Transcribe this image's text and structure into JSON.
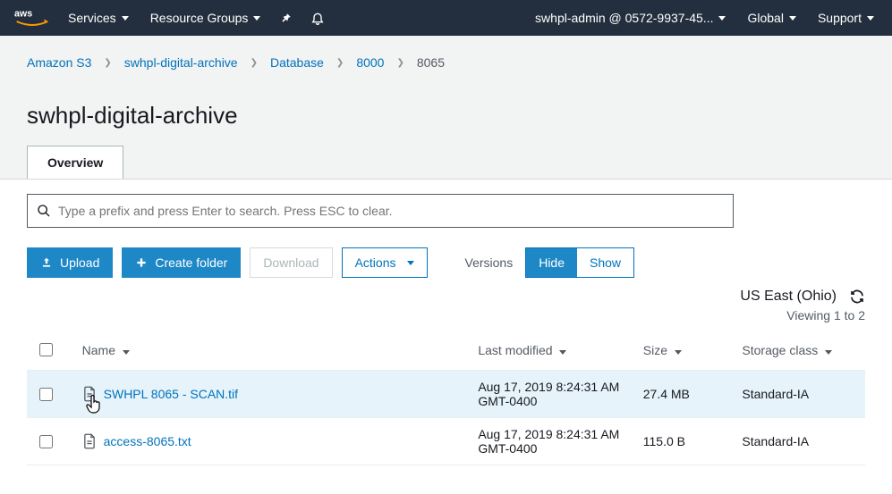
{
  "nav": {
    "services": "Services",
    "resource_groups": "Resource Groups",
    "account": "swhpl-admin @ 0572-9937-45...",
    "region": "Global",
    "support": "Support"
  },
  "breadcrumbs": {
    "root": "Amazon S3",
    "items": [
      "swhpl-digital-archive",
      "Database",
      "8000"
    ],
    "current": "8065"
  },
  "page_title": "swhpl-digital-archive",
  "tabs": {
    "overview": "Overview"
  },
  "search": {
    "placeholder": "Type a prefix and press Enter to search. Press ESC to clear."
  },
  "toolbar": {
    "upload": "Upload",
    "create_folder": "Create folder",
    "download": "Download",
    "actions": "Actions",
    "versions_label": "Versions",
    "hide": "Hide",
    "show": "Show"
  },
  "region_line": "US East (Ohio)",
  "viewing": "Viewing 1 to 2",
  "columns": {
    "name": "Name",
    "last_modified": "Last modified",
    "size": "Size",
    "storage_class": "Storage class"
  },
  "rows": [
    {
      "name": "SWHPL 8065 - SCAN.tif",
      "last_modified": "Aug 17, 2019 8:24:31 AM GMT-0400",
      "size": "27.4 MB",
      "storage_class": "Standard-IA",
      "hovered": true
    },
    {
      "name": "access-8065.txt",
      "last_modified": "Aug 17, 2019 8:24:31 AM GMT-0400",
      "size": "115.0 B",
      "storage_class": "Standard-IA",
      "hovered": false
    }
  ]
}
